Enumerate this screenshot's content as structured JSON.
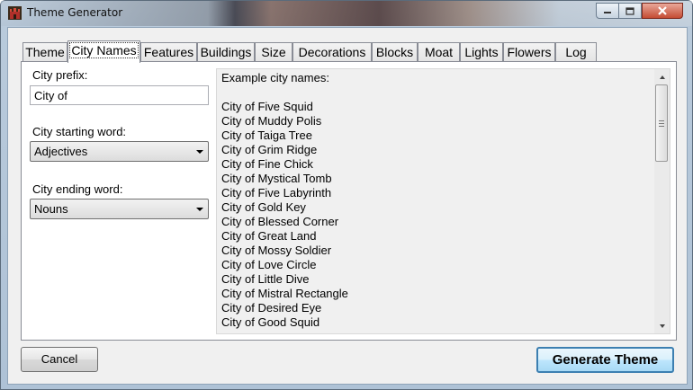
{
  "window": {
    "title": "Theme Generator"
  },
  "tabs": [
    {
      "label": "Theme"
    },
    {
      "label": "City Names",
      "active": true
    },
    {
      "label": "Features"
    },
    {
      "label": "Buildings"
    },
    {
      "label": "Size"
    },
    {
      "label": "Decorations"
    },
    {
      "label": "Blocks"
    },
    {
      "label": "Moat"
    },
    {
      "label": "Lights"
    },
    {
      "label": "Flowers"
    },
    {
      "label": "Log"
    }
  ],
  "form": {
    "prefix_label": "City prefix:",
    "prefix_value": "City of",
    "starting_label": "City starting word:",
    "starting_value": "Adjectives",
    "ending_label": "City ending word:",
    "ending_value": "Nouns"
  },
  "examples": {
    "header": "Example city names:",
    "names": [
      "City of Five Squid",
      "City of Muddy Polis",
      "City of Taiga Tree",
      "City of Grim Ridge",
      "City of Fine Chick",
      "City of Mystical Tomb",
      "City of Five Labyrinth",
      "City of Gold Key",
      "City of Blessed Corner",
      "City of Great Land",
      "City of Mossy Soldier",
      "City of Love Circle",
      "City of Little Dive",
      "City of Mistral Rectangle",
      "City of Desired Eye",
      "City of Good Squid"
    ]
  },
  "buttons": {
    "cancel": "Cancel",
    "generate": "Generate Theme"
  },
  "colors": {
    "default_button_border": "#3c7fb1",
    "close_button": "#c44b33"
  }
}
